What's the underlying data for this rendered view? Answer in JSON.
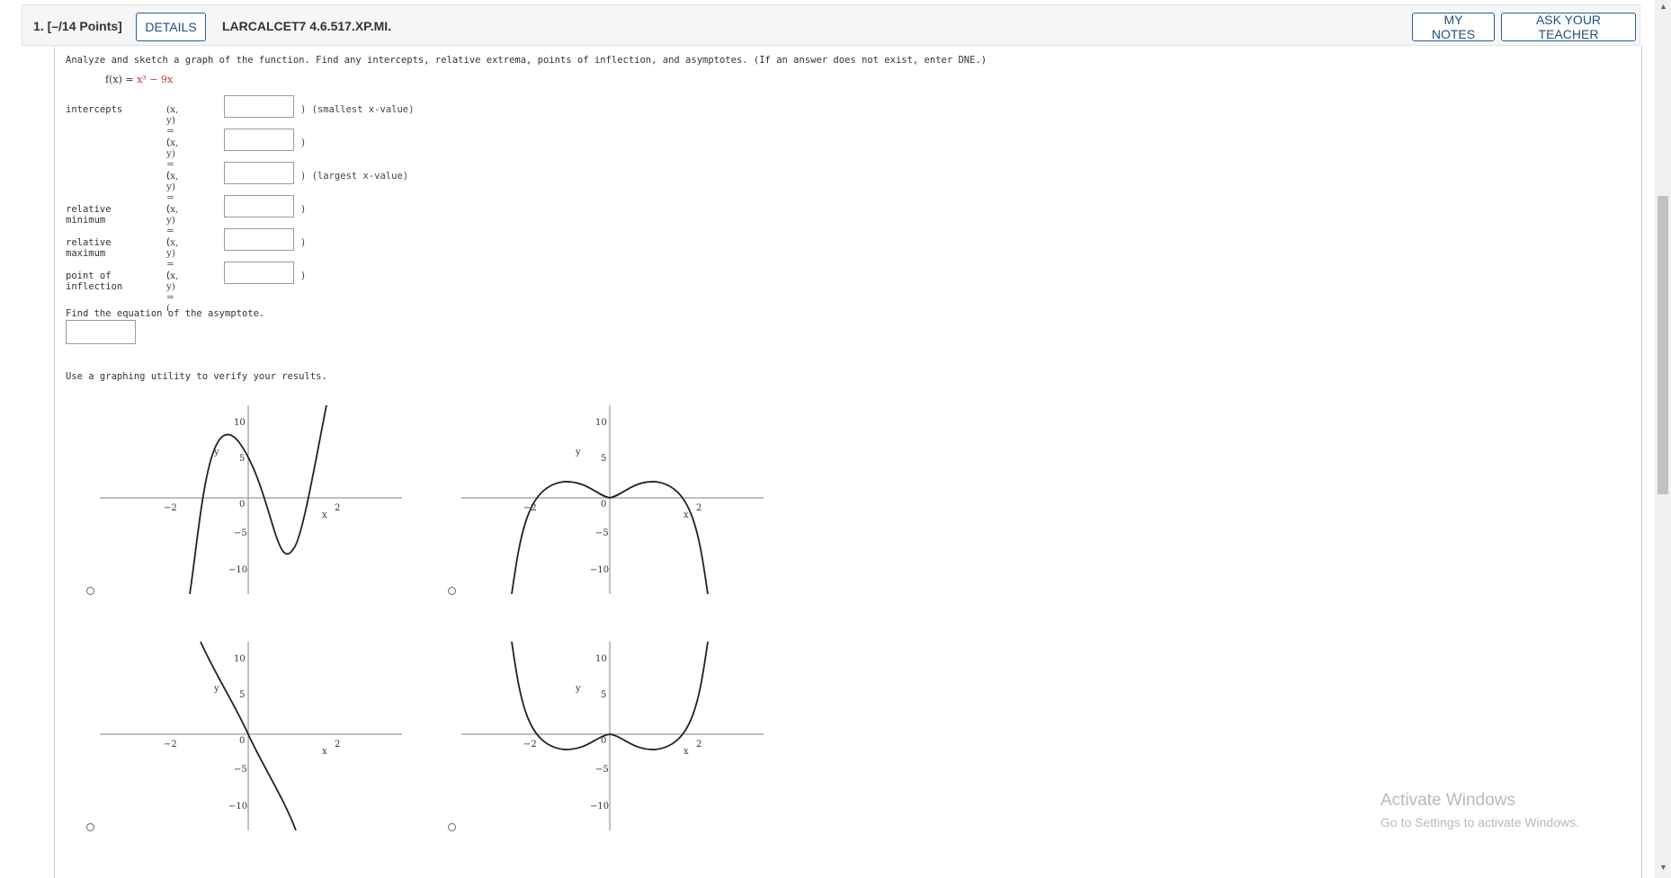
{
  "header": {
    "question_number": "1.  [–/14 Points]",
    "details_label": "DETAILS",
    "question_code": "LARCALCET7 4.6.517.XP.MI.",
    "my_notes_label": "MY NOTES",
    "ask_teacher_label": "ASK YOUR TEACHER"
  },
  "problem": {
    "instruction": "Analyze and sketch a graph of the function. Find any intercepts, relative extrema, points of inflection, and asymptotes. (If an answer does not exist, enter DNE.)",
    "function_prefix": "f(x) = ",
    "function_expr": "x³ − 9x",
    "xy_prefix": "(x, y) = (",
    "rows": [
      {
        "label": "intercepts",
        "after": ") (smallest x-value)"
      },
      {
        "label": "",
        "after": ")"
      },
      {
        "label": "",
        "after": ") (largest x-value)"
      },
      {
        "label": "relative minimum",
        "after": ")"
      },
      {
        "label": "relative maximum",
        "after": ")"
      },
      {
        "label": "point of inflection",
        "after": ")"
      }
    ],
    "asymptote_prompt": "Find the equation of the asymptote.",
    "verify_text": "Use a graphing utility to verify your results."
  },
  "graph_labels": {
    "tick_neg2": "−2",
    "tick_2": "2",
    "tick_10": "10",
    "tick_5": "5",
    "tick_0": "0",
    "tick_neg5": "−5",
    "tick_neg10": "−10",
    "x_axis": "x",
    "y_axis": "y"
  },
  "watermark": {
    "title": "Activate Windows",
    "subtitle": "Go to Settings to activate Windows."
  },
  "colors": {
    "button_border": "#2a5d8f",
    "function_red": "#c0392b"
  }
}
